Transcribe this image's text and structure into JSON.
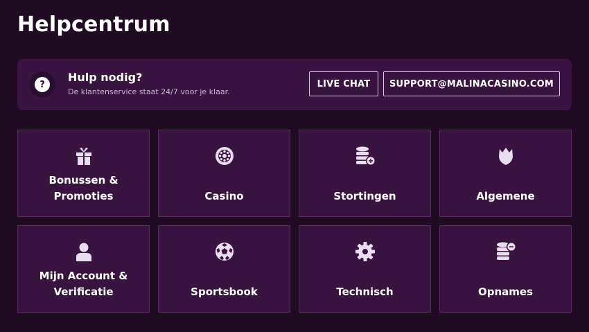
{
  "page": {
    "title": "Helpcentrum"
  },
  "help_banner": {
    "title": "Hulp nodig?",
    "subtitle": "De klantenservice staat 24/7 voor je klaar.",
    "icon": "question-icon",
    "icon_glyph": "?",
    "live_chat_label": "LIVE CHAT",
    "email_label": "SUPPORT@MALINACASINO.COM"
  },
  "categories": [
    {
      "label": "Bonussen &\nPromoties",
      "icon": "gift-icon"
    },
    {
      "label": "Casino",
      "icon": "roulette-icon"
    },
    {
      "label": "Stortingen",
      "icon": "coins-plus-icon"
    },
    {
      "label": "Algemene",
      "icon": "crown-icon"
    },
    {
      "label": "Mijn Account &\nVerificatie",
      "icon": "user-icon"
    },
    {
      "label": "Sportsbook",
      "icon": "soccer-ball-icon"
    },
    {
      "label": "Technisch",
      "icon": "gear-icon"
    },
    {
      "label": "Opnames",
      "icon": "coins-minus-icon"
    }
  ],
  "colors": {
    "background": "#1f0b22",
    "card": "#3a1441",
    "card_border": "#5a2c60",
    "icon": "#e9def0",
    "text": "#ffffff",
    "subtext": "#c9b6cd"
  }
}
